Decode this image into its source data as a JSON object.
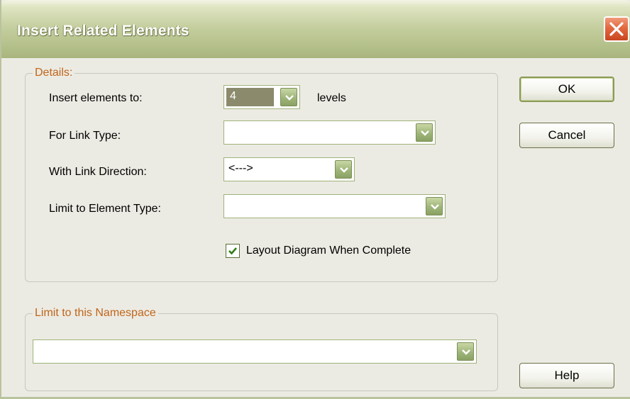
{
  "window": {
    "title": "Insert Related Elements"
  },
  "details": {
    "legend": "Details:",
    "levels_label": "Insert elements to:",
    "levels_value": "4",
    "levels_suffix": "levels",
    "link_type_label": "For Link Type:",
    "link_type_value": "",
    "link_direction_label": "With Link Direction:",
    "link_direction_value": "<--->",
    "element_type_label": "Limit to Element Type:",
    "element_type_value": "",
    "layout_checkbox_label": "Layout Diagram When Complete",
    "layout_checked": true
  },
  "namespace": {
    "legend": "Limit to this Namespace",
    "value": ""
  },
  "buttons": {
    "ok": "OK",
    "cancel": "Cancel",
    "help": "Help"
  },
  "colors": {
    "accent": "#c0651b",
    "title_bar": "#b4c08a",
    "close_button": "#e2683f"
  }
}
